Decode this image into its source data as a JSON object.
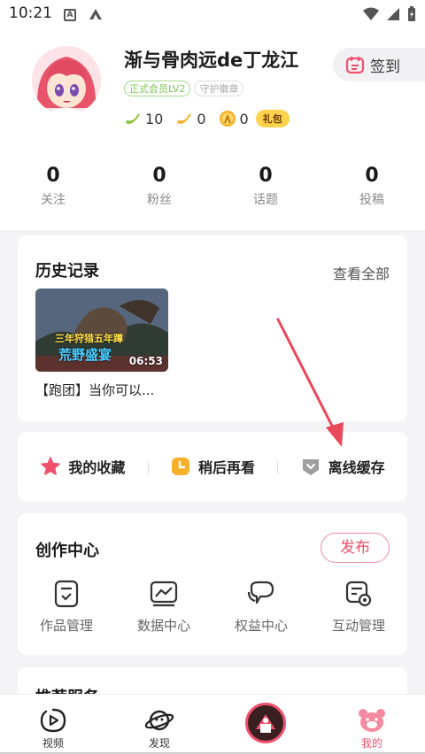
{
  "status_bar": {
    "time": "10:21"
  },
  "profile": {
    "username": "渐与骨肉远de丁龙江",
    "badges": [
      "正式会员LV2",
      "守护徽章"
    ],
    "coins": [
      {
        "icon": "banana-icon",
        "value": "10"
      },
      {
        "icon": "banana-coin-icon",
        "value": "0"
      },
      {
        "icon": "a-coin-icon",
        "value": "0"
      }
    ],
    "gift_label": "礼包",
    "signin_label": "签到"
  },
  "stats": [
    {
      "value": "0",
      "label": "关注"
    },
    {
      "value": "0",
      "label": "粉丝"
    },
    {
      "value": "0",
      "label": "话题"
    },
    {
      "value": "0",
      "label": "投稿"
    }
  ],
  "history": {
    "title": "历史记录",
    "see_all": "查看全部",
    "video": {
      "duration": "06:53",
      "caption_line1": "三年狩猎五年蹲",
      "caption_line2": "荒野盛宴",
      "title": "【跑团】当你可以..."
    }
  },
  "quick_actions": [
    {
      "label": "我的收藏",
      "icon": "star-icon",
      "color": "#f0506e"
    },
    {
      "label": "稍后再看",
      "icon": "watch-later-icon",
      "color": "#f5b12a"
    },
    {
      "label": "离线缓存",
      "icon": "download-icon",
      "color": "#9a9a9a"
    }
  ],
  "creation": {
    "title": "创作中心",
    "publish_label": "发布",
    "tools": [
      "作品管理",
      "数据中心",
      "权益中心",
      "互动管理"
    ]
  },
  "next_section": {
    "title": "推荐服务"
  },
  "bottom_nav": [
    {
      "label": "视频"
    },
    {
      "label": "发现"
    },
    {
      "label": ""
    },
    {
      "label": "我的"
    }
  ],
  "colors": {
    "accent": "#f0506e",
    "gold": "#f5b12a"
  }
}
